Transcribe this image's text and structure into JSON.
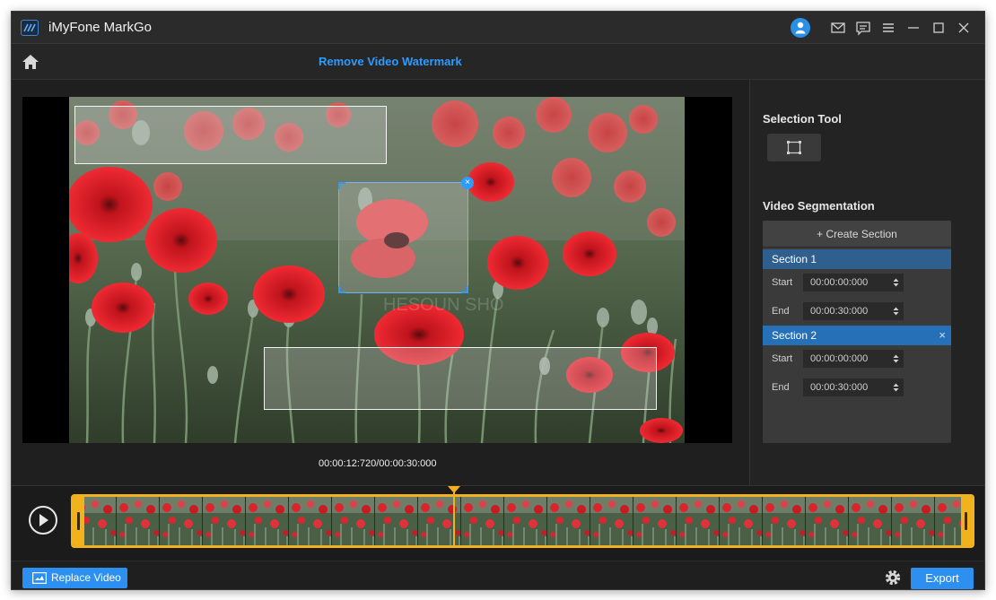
{
  "app": {
    "title": "iMyFone MarkGo"
  },
  "header": {
    "title": "Remove Video Watermark"
  },
  "player": {
    "timecode": "00:00:12:720/00:00:30:000",
    "progress": 0.424
  },
  "selection_tool": {
    "heading": "Selection Tool"
  },
  "segmentation": {
    "heading": "Video Segmentation",
    "create_label": "Create Section",
    "sections": [
      {
        "name": "Section 1",
        "start_label": "Start",
        "start": "00:00:00:000",
        "end_label": "End",
        "end": "00:00:30:000"
      },
      {
        "name": "Section 2",
        "start_label": "Start",
        "start": "00:00:00:000",
        "end_label": "End",
        "end": "00:00:30:000"
      }
    ]
  },
  "watermark_text": "HESOUN    SHO",
  "bottom": {
    "replace_label": "Replace Video",
    "export_label": "Export"
  },
  "colors": {
    "accent": "#2d8ff0",
    "timeline": "#f2b21b",
    "section_active": "#2670b8"
  }
}
